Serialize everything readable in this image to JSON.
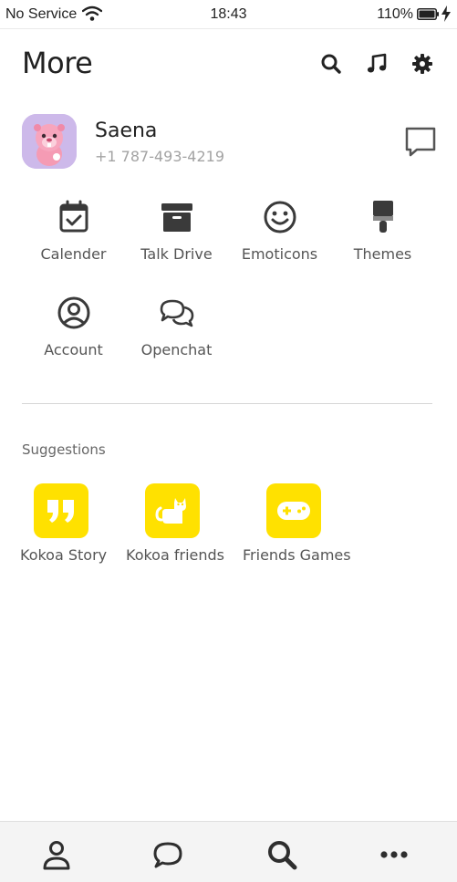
{
  "status_bar": {
    "carrier": "No Service",
    "time": "18:43",
    "battery": "110%"
  },
  "header": {
    "title": "More",
    "icons": [
      "search-icon",
      "music-icon",
      "gear-icon"
    ]
  },
  "profile": {
    "name": "Saena",
    "phone": "+1 787-493-4219"
  },
  "menu": [
    {
      "label": "Calender",
      "icon": "calendar-icon"
    },
    {
      "label": "Talk Drive",
      "icon": "archive-box-icon"
    },
    {
      "label": "Emoticons",
      "icon": "smiley-icon"
    },
    {
      "label": "Themes",
      "icon": "paint-brush-icon"
    },
    {
      "label": "Account",
      "icon": "user-circle-icon"
    },
    {
      "label": "Openchat",
      "icon": "chat-bubbles-icon"
    }
  ],
  "suggestions": {
    "title": "Suggestions",
    "items": [
      {
        "label": "Kokoa Story",
        "icon": "quote-icon"
      },
      {
        "label": "Kokoa friends",
        "icon": "cat-icon"
      },
      {
        "label": "Friends Games",
        "icon": "gamepad-icon"
      }
    ]
  },
  "tab_bar": [
    "person-icon",
    "chat-icon",
    "search-icon",
    "more-dots-icon"
  ],
  "colors": {
    "accent_yellow": "#ffe100",
    "icon_dark": "#3a3a3a",
    "text_muted": "#a3a3a3"
  }
}
